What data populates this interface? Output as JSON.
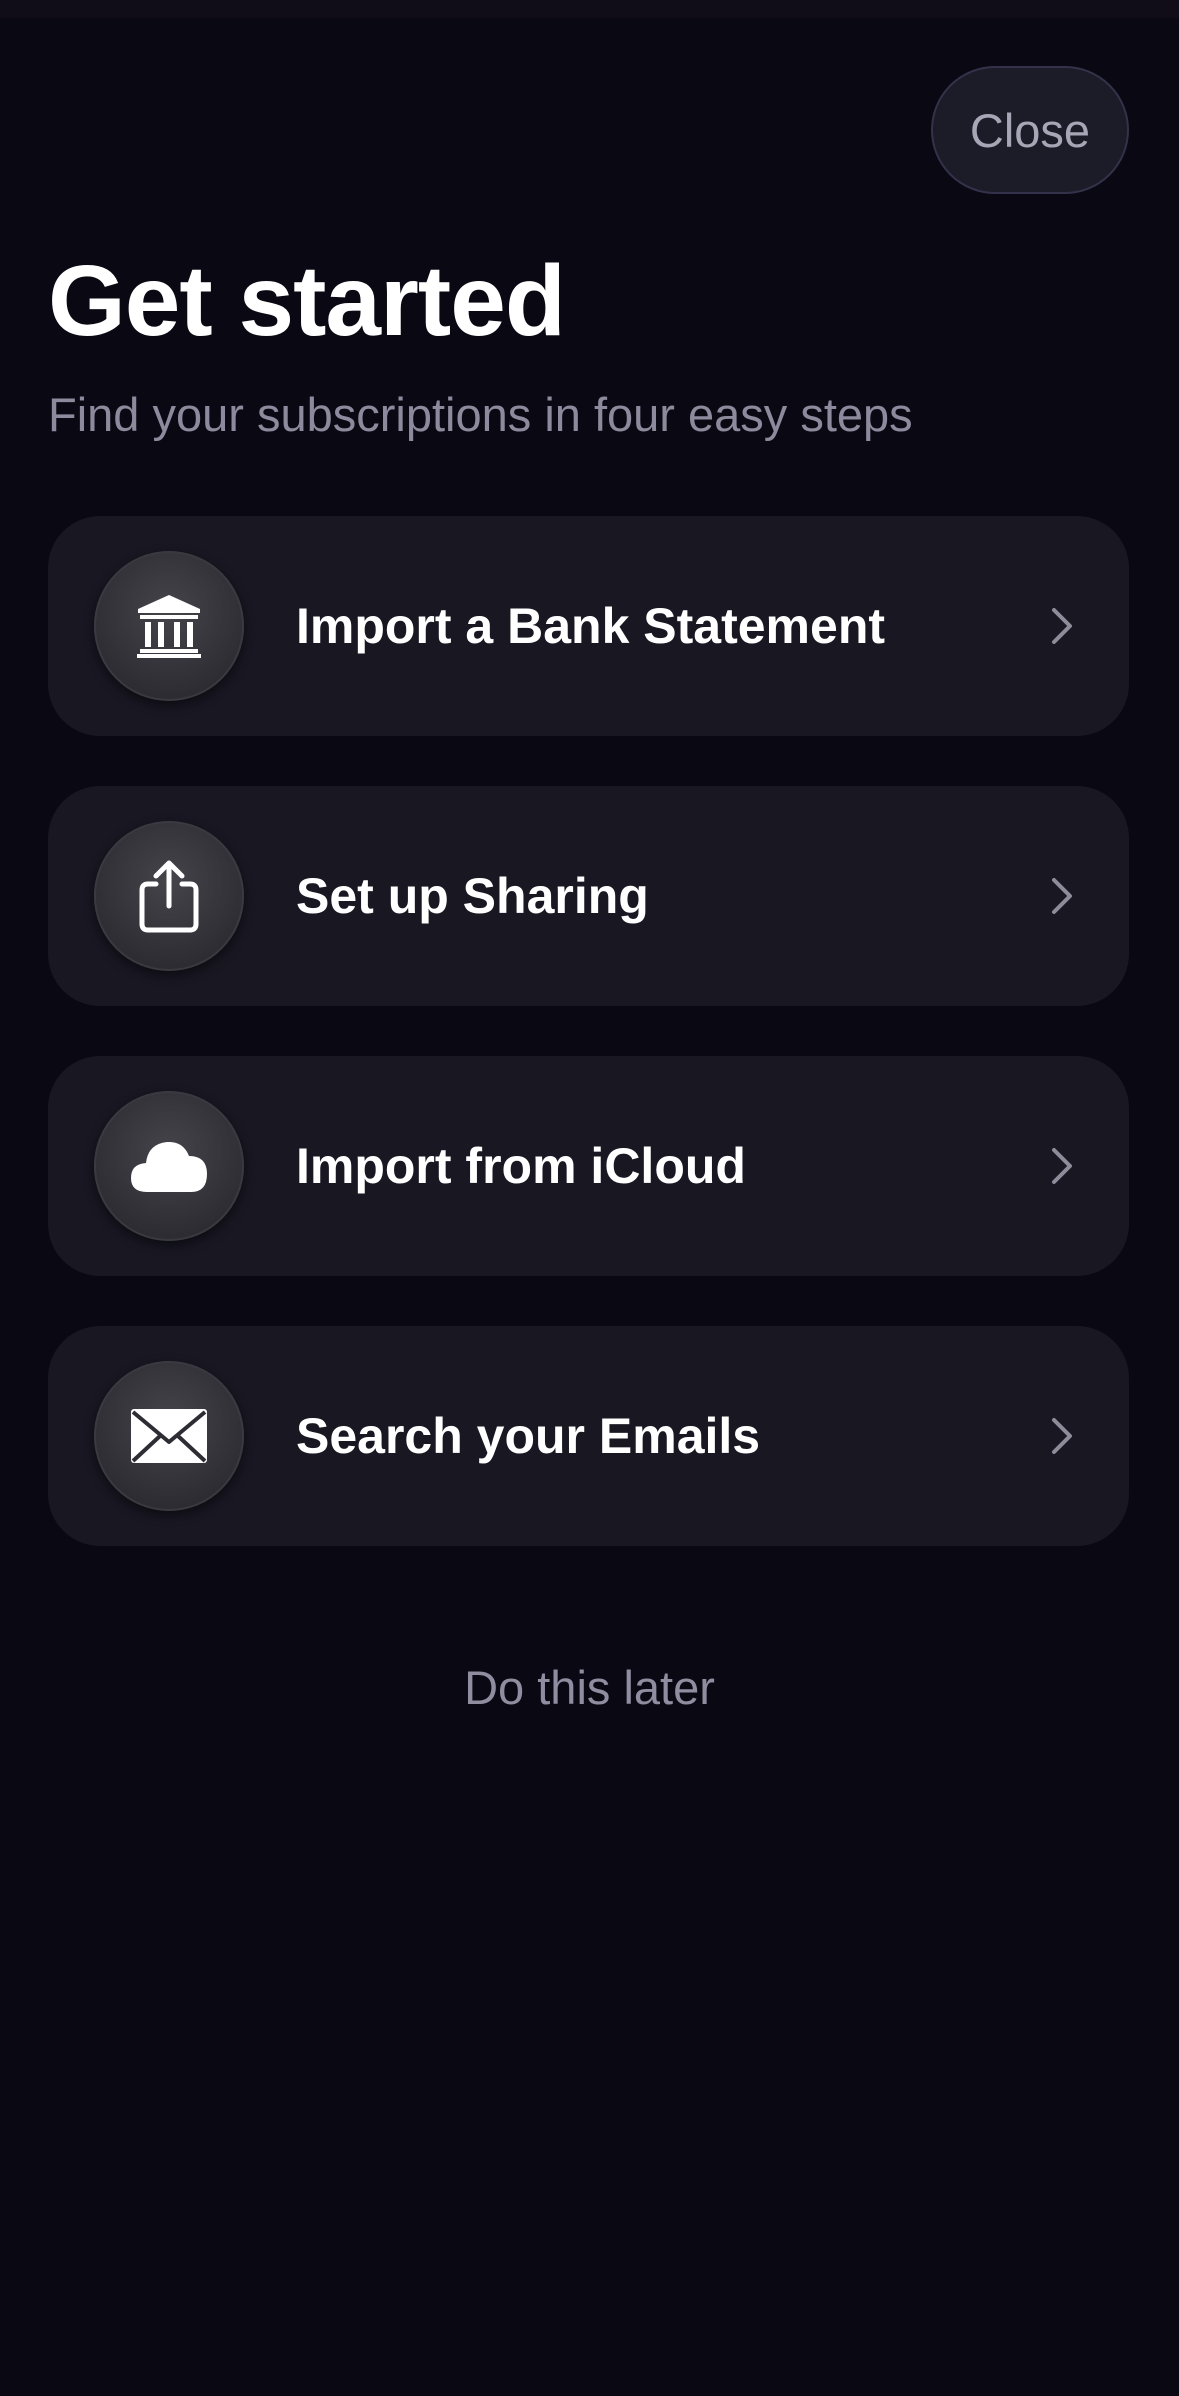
{
  "header": {
    "close_label": "Close"
  },
  "intro": {
    "title": "Get started",
    "subtitle": "Find your subscriptions in four easy steps"
  },
  "steps": [
    {
      "label": "Import a Bank Statement",
      "icon": "bank-icon"
    },
    {
      "label": "Set up Sharing",
      "icon": "share-icon"
    },
    {
      "label": "Import from iCloud",
      "icon": "cloud-icon"
    },
    {
      "label": "Search your Emails",
      "icon": "envelope-icon"
    }
  ],
  "footer": {
    "later_label": "Do this later"
  },
  "colors": {
    "background": "#0a0913",
    "card": "#181722",
    "muted_text": "#8c8a9c"
  }
}
